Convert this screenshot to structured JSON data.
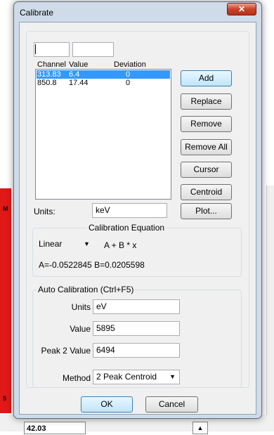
{
  "window": {
    "title": "Calibrate",
    "close_glyph": "✕"
  },
  "top_inputs": {
    "field1_value": "",
    "field2_value": ""
  },
  "list": {
    "headers": [
      "Channel",
      "Value",
      "Deviation"
    ],
    "rows": [
      {
        "channel": "313.83",
        "value": "6.4",
        "deviation": "0",
        "selected": true
      },
      {
        "channel": "850.8",
        "value": "17.44",
        "deviation": "0",
        "selected": false
      }
    ]
  },
  "buttons": {
    "add": "Add",
    "replace": "Replace",
    "remove": "Remove",
    "remove_all": "Remove All",
    "cursor": "Cursor",
    "centroid": "Centroid",
    "plot": "Plot..."
  },
  "units": {
    "label": "Units:",
    "value": "keV"
  },
  "calibration_equation": {
    "title": "Calibration Equation",
    "type": "Linear",
    "formula": "A  +  B * x",
    "coefficients": "A=-0.0522845  B=0.0205598"
  },
  "auto_calibration": {
    "title": "Auto Calibration (Ctrl+F5)",
    "units_label": "Units",
    "units_value": "eV",
    "value_label": "Value",
    "value_value": "5895",
    "peak2_label": "Peak 2 Value",
    "peak2_value": "6494",
    "method_label": "Method",
    "method_value": "2 Peak Centroid"
  },
  "footer": {
    "ok": "OK",
    "cancel": "Cancel"
  },
  "background": {
    "field_value": "42.03",
    "spin_glyph": "▲",
    "marker_top": "M",
    "marker_bottom": "5"
  },
  "colors": {
    "selection": "#3399ff",
    "close_button": "#c7432a",
    "background_plot": "#e01818"
  }
}
